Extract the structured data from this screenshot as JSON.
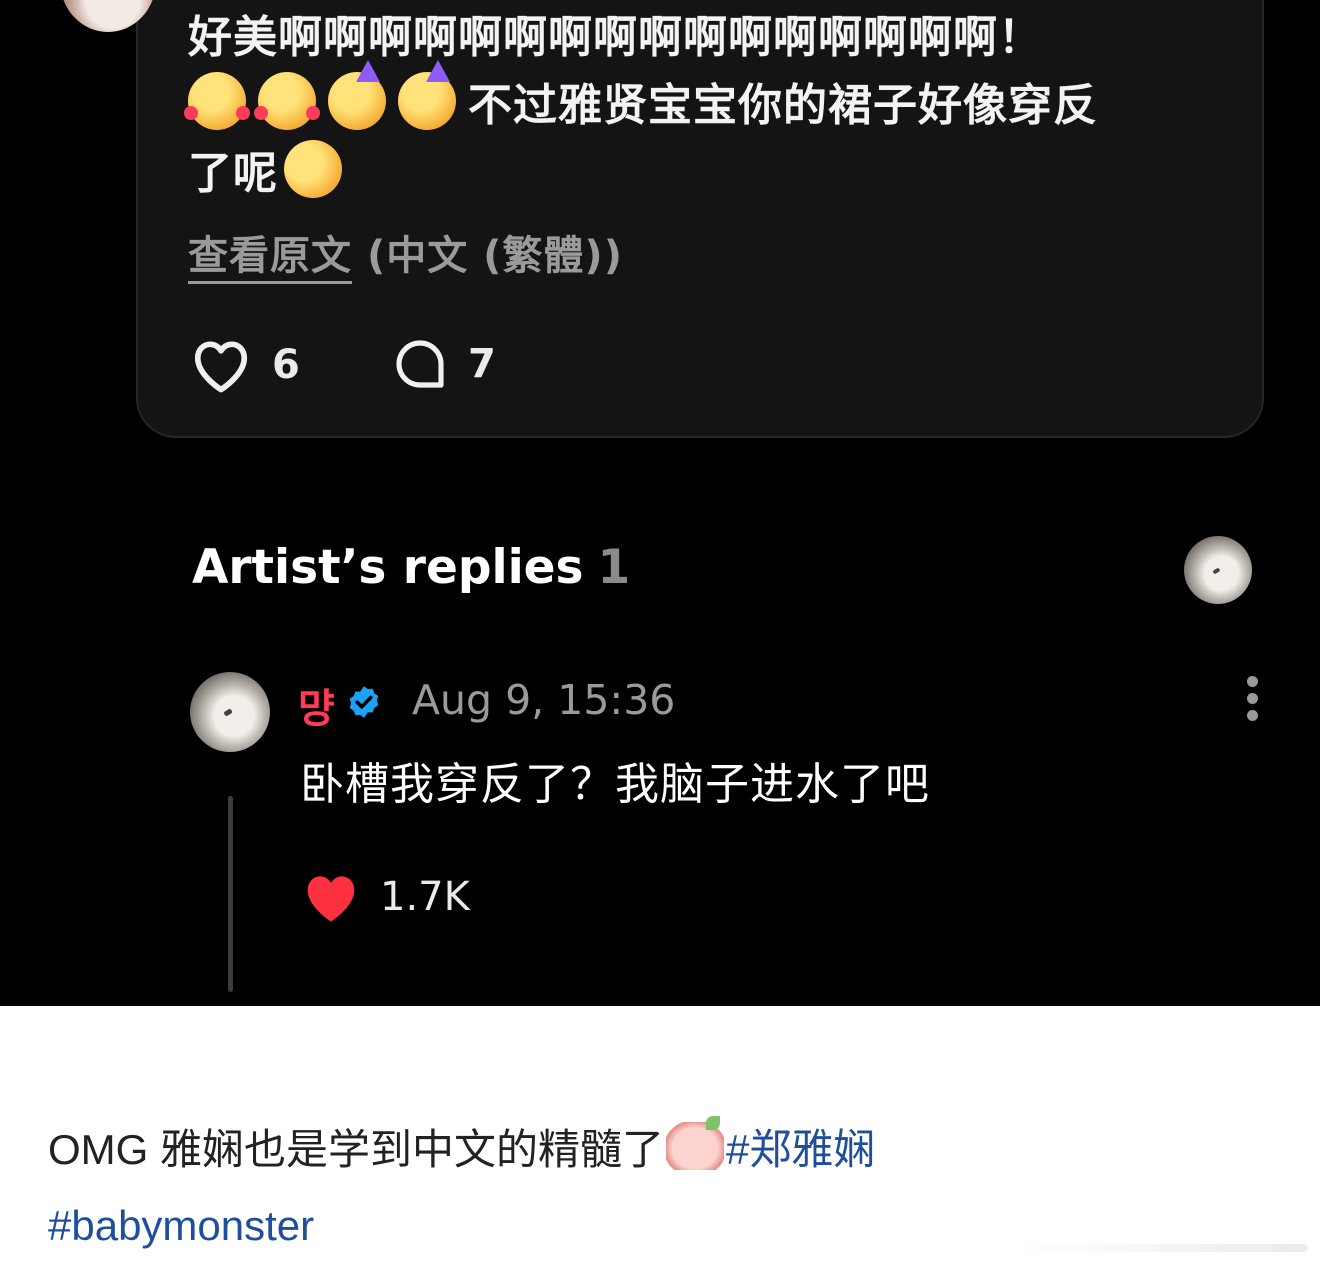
{
  "comment": {
    "line1": "好美啊啊啊啊啊啊啊啊啊啊啊啊啊啊啊啊！",
    "emojis": [
      "smiling-face-with-hearts",
      "smiling-face-with-hearts",
      "partying-face",
      "partying-face"
    ],
    "line2": "不过雅贤宝宝你的裙子好像穿反",
    "line3": "了呢",
    "trailing_emoji": "rolling-on-the-floor-laughing",
    "translate_link": "查看原文",
    "translate_lang": "(中文 (繁體))",
    "likes": "6",
    "replies": "7"
  },
  "artist_replies": {
    "title": "Artist’s replies",
    "count": "1",
    "reply": {
      "username": "먕",
      "verified": true,
      "timestamp": "Aug 9, 15:36",
      "text": "卧槽我穿反了？我脑子进水了吧",
      "likes": "1.7K"
    }
  },
  "caption": {
    "text": "OMG 雅娴也是学到中文的精髓了",
    "hashtag1": "#郑雅娴",
    "hashtag2": "#babymonster"
  },
  "colors": {
    "background": "#000000",
    "card": "#141414",
    "username": "#ff3b57",
    "like_filled": "#ff3040",
    "hashtag": "#1f4f9c",
    "verified": "#1da1f2"
  }
}
